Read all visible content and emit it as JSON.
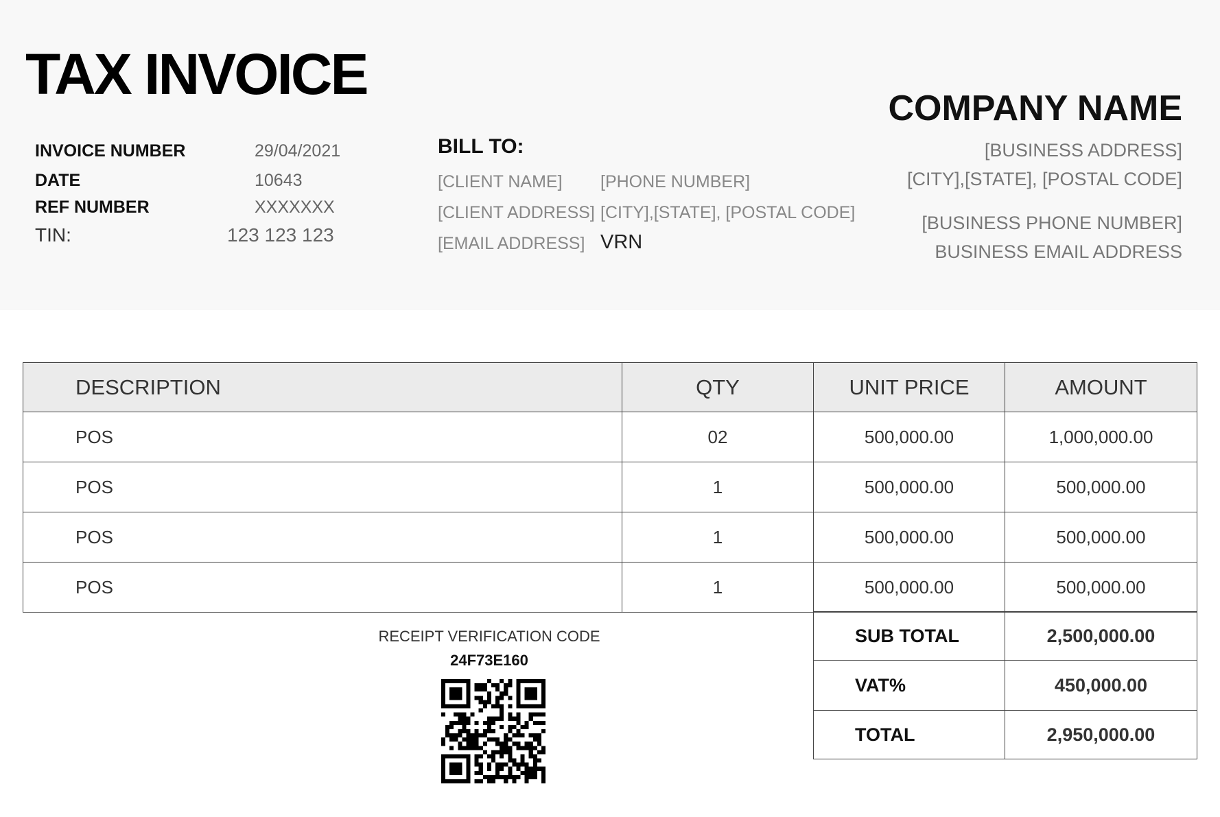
{
  "document": {
    "title": "TAX INVOICE"
  },
  "invoice_meta": [
    {
      "label": "INVOICE NUMBER",
      "value": "29/04/2021"
    },
    {
      "label": "DATE",
      "value": "10643"
    },
    {
      "label": "REF NUMBER",
      "value": "XXXXXXX"
    },
    {
      "label": "TIN:",
      "value": "123 123 123"
    }
  ],
  "bill_to": {
    "heading": "BILL TO:",
    "client_name": "[CLIENT NAME]",
    "phone_number": "[PHONE NUMBER]",
    "client_address": "[CLIENT ADDRESS]",
    "city_state_postal": "[CITY],[STATE], [POSTAL CODE]",
    "email_address": "[EMAIL ADDRESS]",
    "vrn": "VRN"
  },
  "company": {
    "name": "COMPANY NAME",
    "business_address": "[BUSINESS ADDRESS]",
    "city_state_postal": "[CITY],[STATE], [POSTAL CODE]",
    "business_phone": "[BUSINESS PHONE NUMBER]",
    "business_email": "BUSINESS EMAIL ADDRESS"
  },
  "items_table": {
    "headers": {
      "description": "DESCRIPTION",
      "qty": "QTY",
      "unit_price": "UNIT PRICE",
      "amount": "AMOUNT"
    },
    "rows": [
      {
        "description": "POS",
        "qty": "02",
        "unit_price": "500,000.00",
        "amount": "1,000,000.00"
      },
      {
        "description": "POS",
        "qty": "1",
        "unit_price": "500,000.00",
        "amount": "500,000.00"
      },
      {
        "description": "POS",
        "qty": "1",
        "unit_price": "500,000.00",
        "amount": "500,000.00"
      },
      {
        "description": "POS",
        "qty": "1",
        "unit_price": "500,000.00",
        "amount": "500,000.00"
      }
    ]
  },
  "totals": {
    "sub_total_label": "SUB TOTAL",
    "sub_total": "2,500,000.00",
    "vat_label": "VAT%",
    "vat": "450,000.00",
    "total_label": "TOTAL",
    "total": "2,950,000.00"
  },
  "verification": {
    "label": "RECEIPT VERIFICATION CODE",
    "code": "24F73E160",
    "qr_icon": "qr-code-icon"
  },
  "colors": {
    "header_background": "#f8f8f8",
    "table_header_background": "#ebebeb"
  }
}
